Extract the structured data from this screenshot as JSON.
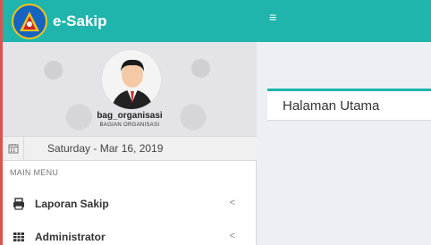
{
  "brand": {
    "title": "e-Sakip",
    "logo_icon": "emblem-icon",
    "color": "#1fb5ac"
  },
  "user": {
    "name": "bag_organisasi",
    "role": "BAGIAN ORGANISASI"
  },
  "date": {
    "text": "Saturday - Mar 16, 2019",
    "icon": "calendar-icon"
  },
  "menu": {
    "header": "MAIN MENU",
    "items": [
      {
        "label": "Laporan Sakip",
        "icon": "printer-icon",
        "chevron": "<"
      },
      {
        "label": "Administrator",
        "icon": "table-icon",
        "chevron": "<"
      }
    ]
  },
  "topbar": {
    "toggle_icon": "hamburger-icon",
    "toggle_glyph": "≡"
  },
  "content": {
    "box_title": "Halaman Utama"
  }
}
